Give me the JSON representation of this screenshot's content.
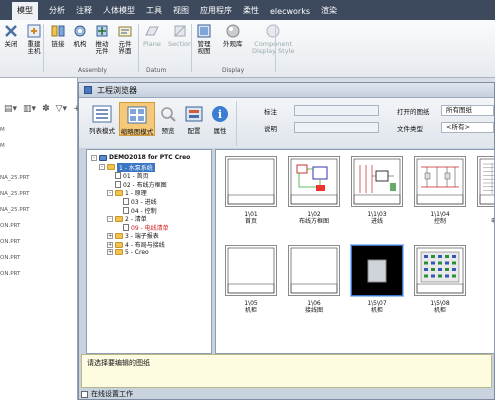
{
  "menu": {
    "items": [
      "模型",
      "分析",
      "注释",
      "人体模型",
      "工具",
      "视图",
      "应用程序",
      "柔性",
      "elecworks",
      "渲染"
    ],
    "active_index": 0
  },
  "ribbon": {
    "buttons": [
      {
        "label": "关闭",
        "icon": "close-icon"
      },
      {
        "label": "重建\n主机",
        "icon": "rebuild-icon"
      },
      {
        "label": "链接",
        "icon": "link-icon"
      },
      {
        "label": "机构",
        "icon": "mechanism-icon"
      },
      {
        "label": "推动\n元件",
        "icon": "push-icon"
      },
      {
        "label": "元件\n界面",
        "icon": "component-interface-icon"
      },
      {
        "label": "Plane",
        "icon": "plane-icon",
        "disabled": true
      },
      {
        "label": "Section",
        "icon": "section-icon",
        "disabled": true
      },
      {
        "label": "管理\n视图",
        "icon": "manage-views-icon"
      },
      {
        "label": "外观库",
        "icon": "appearance-icon"
      },
      {
        "label": "Component\nDisplay Style",
        "icon": "display-style-icon",
        "disabled": true
      }
    ],
    "groups": [
      "Assembly",
      "Datum",
      "Display"
    ]
  },
  "left_panel": {
    "items": [
      "M",
      "M",
      "NA_25.PRT",
      "NA_25.PRT",
      "NA_25.PRT",
      "ON.PRT",
      "ON.PRT",
      "ON.PRT",
      "ON.PRT"
    ]
  },
  "window": {
    "title": "工程浏览器",
    "toolbar": {
      "buttons": [
        {
          "label": "列表模式",
          "icon": "list-mode-icon",
          "active": false
        },
        {
          "label": "缩略图模式",
          "icon": "thumbnail-mode-icon",
          "active": true
        },
        {
          "label": "预览",
          "icon": "preview-icon",
          "active": false
        },
        {
          "label": "配置",
          "icon": "config-icon",
          "active": false
        },
        {
          "label": "属性",
          "icon": "info-icon",
          "active": false
        }
      ],
      "browse_label": "浏览",
      "filter_label": "筛选",
      "fields": {
        "tag_label": "标注",
        "desc_label": "说明",
        "open_label": "打开的图纸",
        "open_value": "所有图纸",
        "filetype_label": "文件类型",
        "filetype_value": "<所有>"
      }
    },
    "tree": [
      {
        "label": "DEMO2018 for PTC Creo",
        "level": 0,
        "type": "project",
        "expand": "-"
      },
      {
        "label": "1 - 水泵系统",
        "level": 1,
        "type": "folder",
        "expand": "-",
        "selected": true
      },
      {
        "label": "01 - 首页",
        "level": 2,
        "type": "doc"
      },
      {
        "label": "02 - 布线方框图",
        "level": 2,
        "type": "doc"
      },
      {
        "label": "1 - 原理",
        "level": 2,
        "type": "folder",
        "expand": "-"
      },
      {
        "label": "03 - 进线",
        "level": 3,
        "type": "doc"
      },
      {
        "label": "04 - 控制",
        "level": 3,
        "type": "doc"
      },
      {
        "label": "2 - 清单",
        "level": 2,
        "type": "folder",
        "expand": "-"
      },
      {
        "label": "09 - 电线清单",
        "level": 3,
        "type": "doc",
        "red": true
      },
      {
        "label": "3 - 端子报表",
        "level": 2,
        "type": "folder",
        "expand": "+"
      },
      {
        "label": "4 - 布局与接线",
        "level": 2,
        "type": "folder",
        "expand": "+"
      },
      {
        "label": "5 - Creo",
        "level": 2,
        "type": "folder",
        "expand": "+"
      }
    ],
    "thumbnails": [
      {
        "code": "1\\01",
        "name": "首页",
        "style": "blank"
      },
      {
        "code": "1\\02",
        "name": "布线方框图",
        "style": "block"
      },
      {
        "code": "1\\1\\03",
        "name": "进线",
        "style": "schematic"
      },
      {
        "code": "1\\1\\04",
        "name": "控制",
        "style": "schematic2"
      },
      {
        "code": "1\\09",
        "name": "电线清单",
        "style": "list"
      },
      {
        "code": "1\\05",
        "name": "机柜",
        "style": "blank"
      },
      {
        "code": "1\\06",
        "name": "接线图",
        "style": "blank"
      },
      {
        "code": "1\\5\\07",
        "name": "机柜",
        "style": "dark"
      },
      {
        "code": "1\\5\\08",
        "name": "机柜",
        "style": "pcb"
      }
    ],
    "status_text": "请选择要编辑的图纸",
    "bottom_label": "在线设置工作"
  }
}
